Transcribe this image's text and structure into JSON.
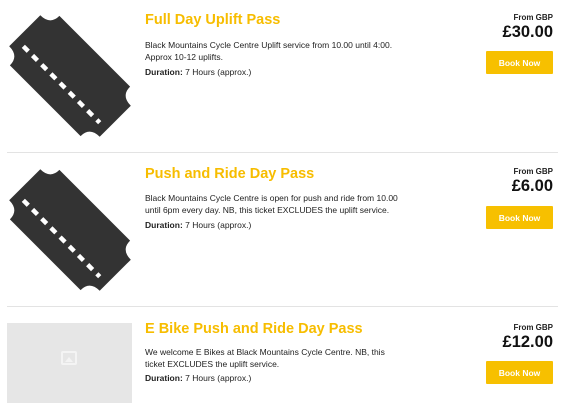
{
  "passes": [
    {
      "title": "Full Day Uplift Pass",
      "description": "Black Mountains Cycle Centre Uplift service from 10.00 until 4:00. Approx 10-12 uplifts.",
      "duration_label": "Duration:",
      "duration_value": " 7 Hours (approx.)",
      "price_prefix": "From GBP",
      "price": "£30.00",
      "button_label": "Book Now",
      "image": "ticket-icon"
    },
    {
      "title": "Push and Ride Day Pass",
      "description": "Black Mountains Cycle Centre is open for push and ride from 10.00 until 6pm every day. NB, this ticket EXCLUDES the uplift service.",
      "duration_label": "Duration:",
      "duration_value": " 7 Hours (approx.)",
      "price_prefix": "From GBP",
      "price": "£6.00",
      "button_label": "Book Now",
      "image": "ticket-icon"
    },
    {
      "title": "E Bike Push and Ride Day Pass",
      "description": "We welcome E Bikes at Black Mountains Cycle Centre. NB, this ticket EXCLUDES the uplift service.",
      "duration_label": "Duration:",
      "duration_value": " 7 Hours (approx.)",
      "price_prefix": "From GBP",
      "price": "£12.00",
      "button_label": "Book Now",
      "image": "image-placeholder-icon"
    }
  ],
  "colors": {
    "accent": "#f7c000",
    "title": "#f7bd00",
    "ticket": "#333333",
    "divider": "#e3e3e3",
    "placeholder": "#e6e6e6"
  }
}
